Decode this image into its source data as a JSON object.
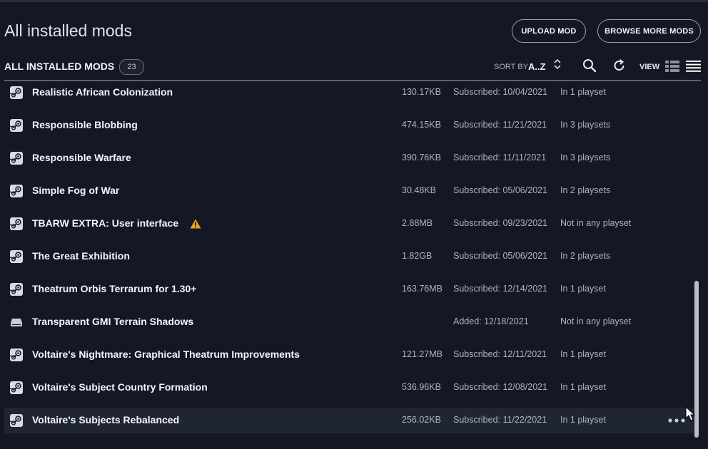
{
  "header": {
    "title": "All installed mods",
    "upload_label": "UPLOAD MOD",
    "browse_label": "BROWSE MORE MODS"
  },
  "toolbar": {
    "section_title": "ALL INSTALLED MODS",
    "count": "23",
    "sort_label": "SORT BY",
    "sort_value": "A..Z",
    "view_label": "VIEW"
  },
  "mods": [
    {
      "name": "Realistic African Colonization",
      "size": "130.17KB",
      "date": "Subscribed: 10/04/2021",
      "playsets": "In 1 playset",
      "source": "steam",
      "warning": false
    },
    {
      "name": "Responsible Blobbing",
      "size": "474.15KB",
      "date": "Subscribed: 11/21/2021",
      "playsets": "In 3 playsets",
      "source": "steam",
      "warning": false
    },
    {
      "name": "Responsible Warfare",
      "size": "390.76KB",
      "date": "Subscribed: 11/11/2021",
      "playsets": "In 3 playsets",
      "source": "steam",
      "warning": false
    },
    {
      "name": "Simple Fog of War",
      "size": "30.48KB",
      "date": "Subscribed: 05/06/2021",
      "playsets": "In 2 playsets",
      "source": "steam",
      "warning": false
    },
    {
      "name": "TBARW EXTRA: User interface",
      "size": "2.88MB",
      "date": "Subscribed: 09/23/2021",
      "playsets": "Not in any playset",
      "source": "steam",
      "warning": true
    },
    {
      "name": "The Great Exhibition",
      "size": "1.82GB",
      "date": "Subscribed: 05/06/2021",
      "playsets": "In 2 playsets",
      "source": "steam",
      "warning": false
    },
    {
      "name": "Theatrum Orbis Terrarum for 1.30+",
      "size": "163.76MB",
      "date": "Subscribed: 12/14/2021",
      "playsets": "In 1 playset",
      "source": "steam",
      "warning": false
    },
    {
      "name": "Transparent GMI Terrain Shadows",
      "size": "",
      "date": "Added: 12/18/2021",
      "playsets": "Not in any playset",
      "source": "local",
      "warning": false
    },
    {
      "name": "Voltaire's Nightmare: Graphical Theatrum Improvements",
      "size": "121.27MB",
      "date": "Subscribed: 12/11/2021",
      "playsets": "In 1 playset",
      "source": "steam",
      "warning": false
    },
    {
      "name": "Voltaire's Subject Country Formation",
      "size": "536.96KB",
      "date": "Subscribed: 12/08/2021",
      "playsets": "In 1 playset",
      "source": "steam",
      "warning": false
    },
    {
      "name": "Voltaire's Subjects Rebalanced",
      "size": "256.02KB",
      "date": "Subscribed: 11/22/2021",
      "playsets": "In 1 playset",
      "source": "steam",
      "warning": false,
      "hovered": true
    }
  ],
  "colors": {
    "background": "#141824",
    "row_hover": "#1f2532",
    "warning": "#f0a020",
    "muted_text": "#aeb3bf"
  },
  "icons": {
    "steam": "steam-icon",
    "local": "drive-icon",
    "warning": "warning-icon"
  }
}
